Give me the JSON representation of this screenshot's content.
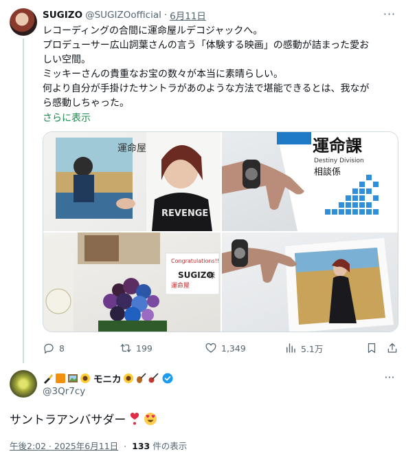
{
  "tweet": {
    "author_name": "SUGIZO",
    "author_handle": "@SUGIZOofficial",
    "separator": "·",
    "date": "6月11日",
    "more_label": "···",
    "lines": [
      "レコーディングの合間に運命屋ルデコジャックへ。",
      "プロデューサー広山詞葉さんの言う「体験する映画」の感動が詰まった愛お",
      "しい空間。",
      "ミッキーさんの貴重なお宝の数々が本当に素晴らしい。",
      "何より自分が手掛けたサントラがあのような方法で堪能できるとは、我なが",
      "ら感動しちゃった。"
    ],
    "show_more": "さらに表示",
    "photos": {
      "poster_title": "運命屋",
      "shirt_text": "REVENGE",
      "sign_title": "運命課",
      "sign_sub": "Destiny Division",
      "sign_dept": "相談係",
      "congrats": "Congratulations!!",
      "congrats_name": "SUGIZO",
      "congrats_sama": "様",
      "shop_label": "運命屋"
    },
    "actions": {
      "replies": "8",
      "retweets": "199",
      "likes": "1,349",
      "views": "5.1万"
    }
  },
  "reply": {
    "display_name": "モニカ",
    "handle": "@3Qr7cy",
    "more_label": "···",
    "text": "サントラアンバサダー",
    "time": "午後2:02 · 2025年6月11日",
    "separator": "·",
    "view_count": "133",
    "view_label": "件の表示"
  },
  "colors": {
    "text": "#0f1419",
    "muted": "#536471",
    "link": "#1a8a4a",
    "border": "#cfd9de",
    "verified": "#1d9bf0",
    "heart": "#e0245e"
  }
}
